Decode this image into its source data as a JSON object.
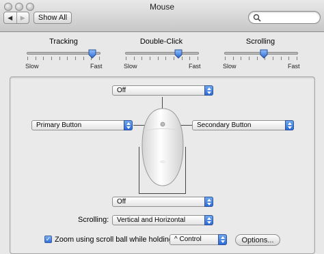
{
  "window": {
    "title": "Mouse"
  },
  "toolbar": {
    "show_all_label": "Show All",
    "search_placeholder": ""
  },
  "sliders": {
    "tracking": {
      "title": "Tracking",
      "min_label": "Slow",
      "max_label": "Fast",
      "value_fraction": 0.95
    },
    "double_click": {
      "title": "Double-Click",
      "min_label": "Slow",
      "max_label": "Fast",
      "value_fraction": 0.76
    },
    "scrolling": {
      "title": "Scrolling",
      "min_label": "Slow",
      "max_label": "Fast",
      "value_fraction": 0.54
    }
  },
  "mouse_buttons": {
    "top_popup": "Off",
    "left_popup": "Primary Button",
    "right_popup": "Secondary Button",
    "bottom_popup": "Off"
  },
  "scrolling_popup": {
    "label": "Scrolling:",
    "value": "Vertical and Horizontal"
  },
  "zoom": {
    "checkbox_label": "Zoom using scroll ball while holding",
    "checked": true,
    "modifier_value": "^ Control",
    "options_label": "Options..."
  },
  "colors": {
    "accent": "#2c6bd6",
    "window_bg": "#e8e8e8"
  }
}
